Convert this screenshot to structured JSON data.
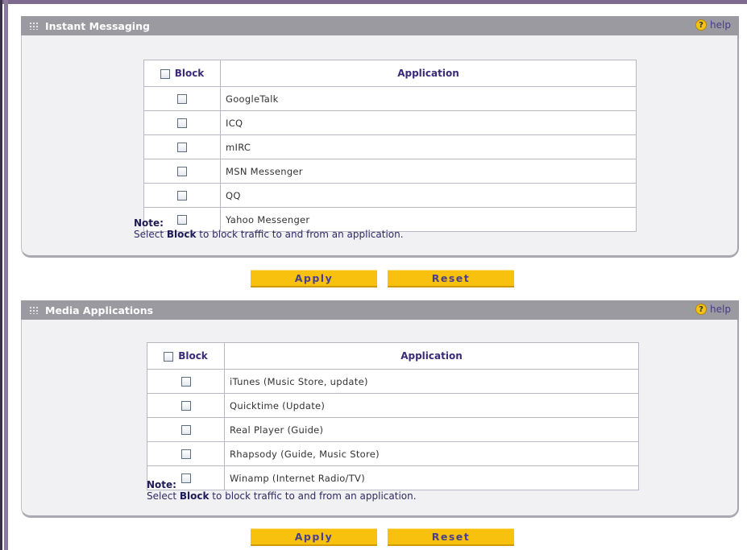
{
  "instant_messaging": {
    "title": "Instant Messaging",
    "help_label": "help",
    "columns": {
      "block": "Block",
      "application": "Application"
    },
    "rows": [
      {
        "name": "GoogleTalk"
      },
      {
        "name": "ICQ"
      },
      {
        "name": "mIRC"
      },
      {
        "name": "MSN Messenger"
      },
      {
        "name": "QQ"
      },
      {
        "name": "Yahoo Messenger"
      }
    ],
    "note_label": "Note:",
    "note_text_pre": "Select ",
    "note_text_bold": "Block",
    "note_text_post": " to block traffic to and from an application.",
    "apply_label": "Apply",
    "reset_label": "Reset"
  },
  "media_applications": {
    "title": "Media Applications",
    "help_label": "help",
    "columns": {
      "block": "Block",
      "application": "Application"
    },
    "rows": [
      {
        "name": "iTunes (Music Store, update)"
      },
      {
        "name": "Quicktime (Update)"
      },
      {
        "name": "Real Player (Guide)"
      },
      {
        "name": "Rhapsody (Guide, Music Store)"
      },
      {
        "name": "Winamp (Internet Radio/TV)"
      }
    ],
    "note_label": "Note:",
    "note_text_pre": "Select ",
    "note_text_bold": "Block",
    "note_text_post": " to block traffic to and from an application.",
    "apply_label": "Apply",
    "reset_label": "Reset"
  },
  "icons": {
    "help": "help-icon",
    "grip": "grip-icon",
    "checkbox": "checkbox"
  },
  "colors": {
    "header_bg": "#9a9aa0",
    "button_bg": "#f8c10d",
    "text_accent": "#3a2b78"
  }
}
